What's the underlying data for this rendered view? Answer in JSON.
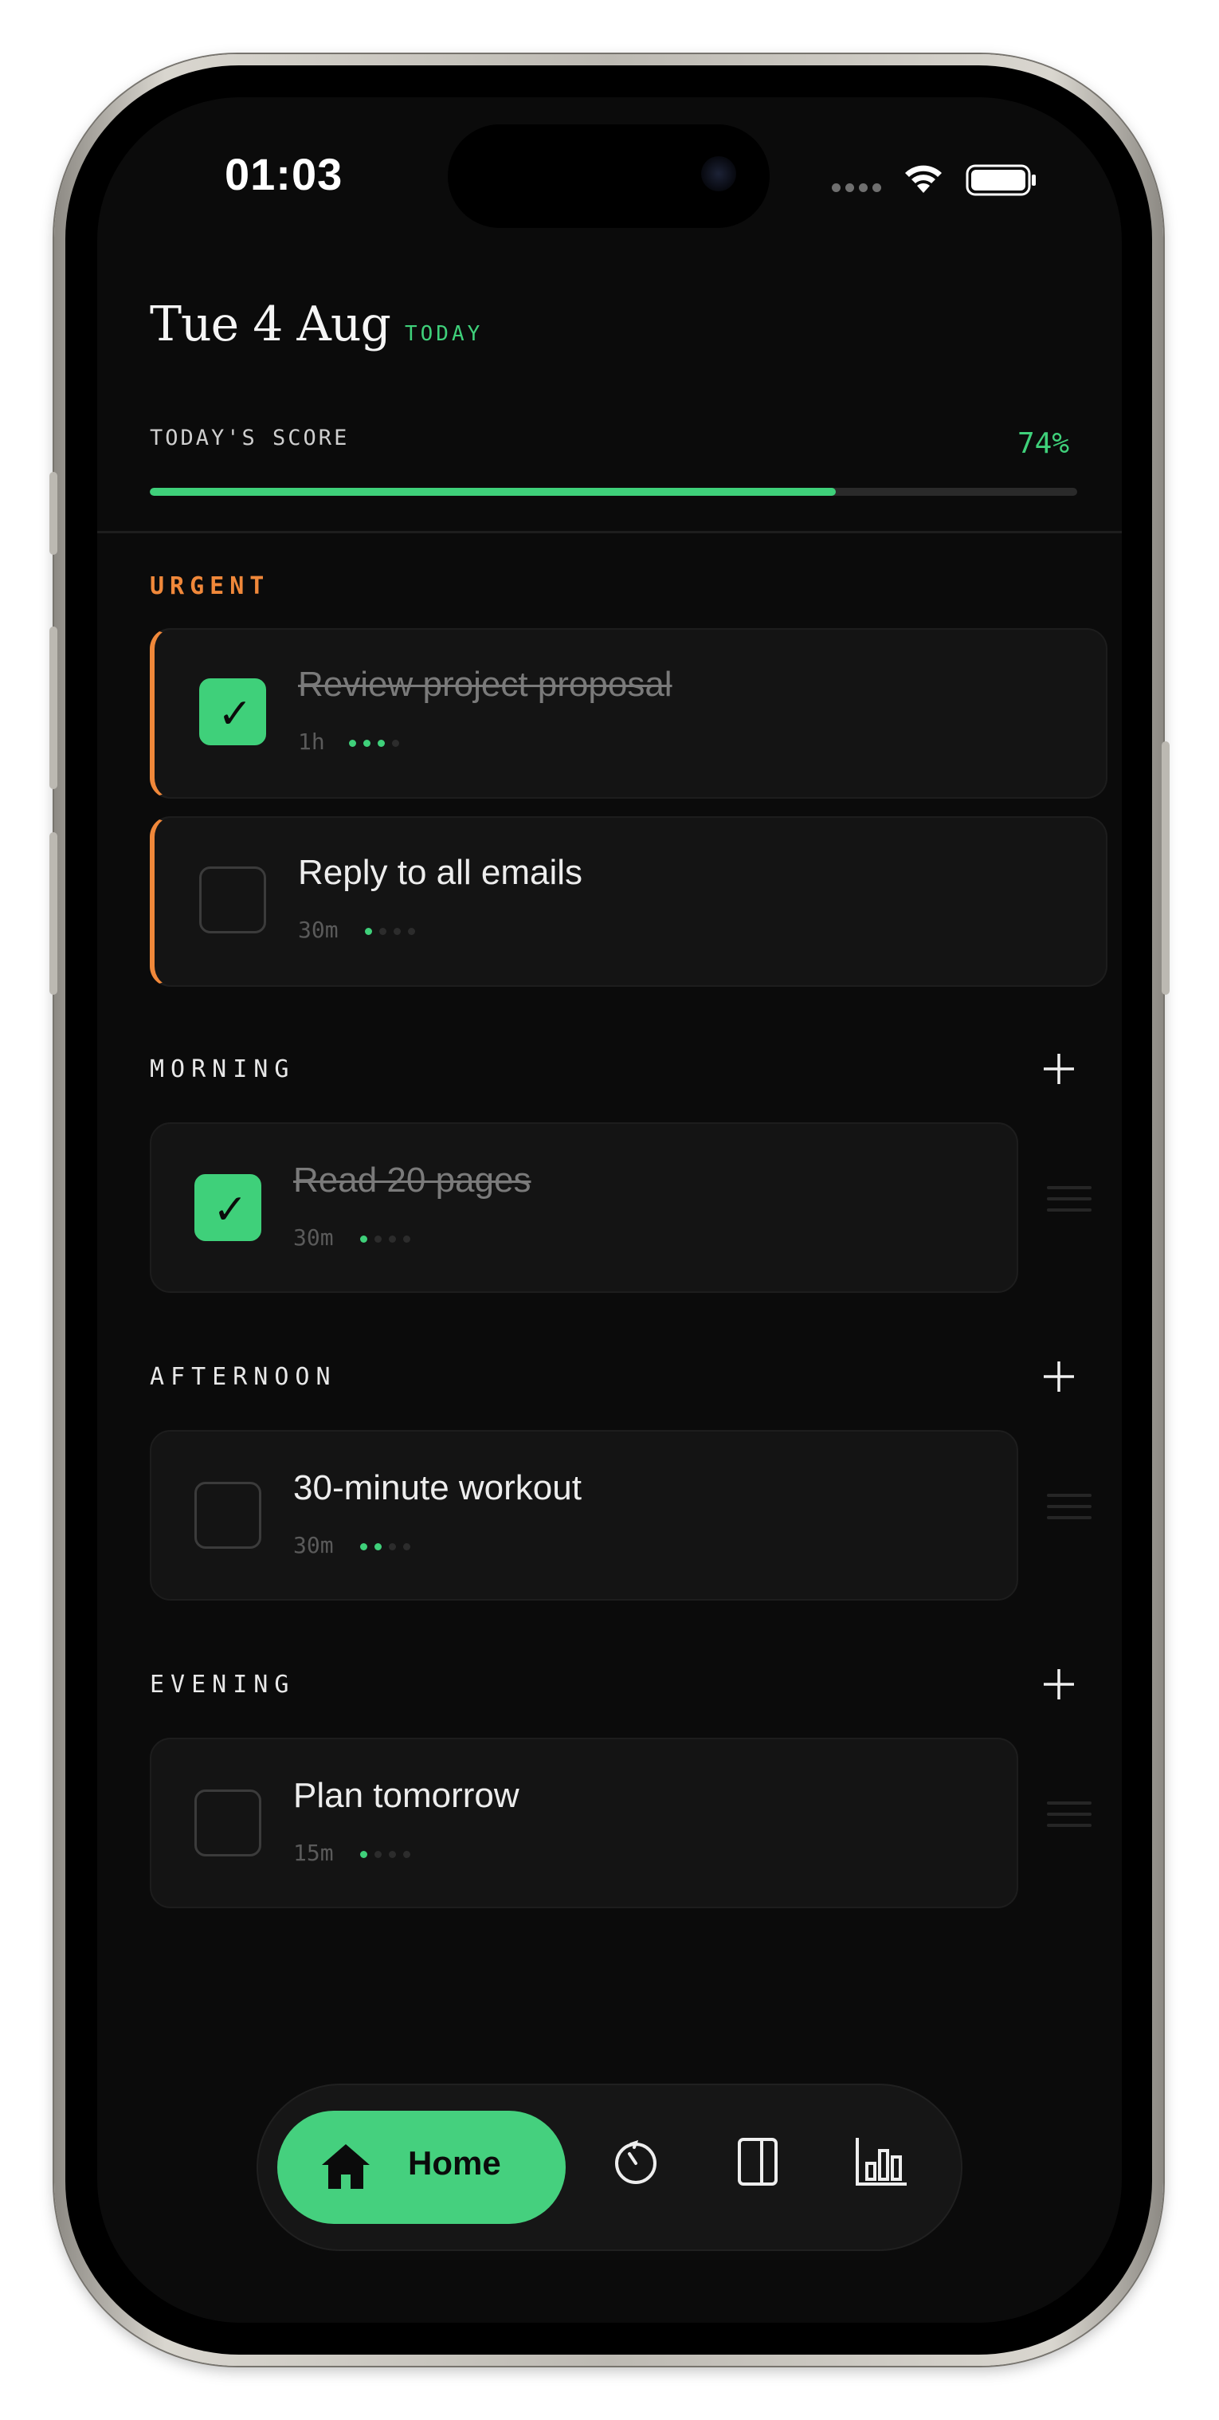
{
  "status_bar": {
    "time": "01:03"
  },
  "header": {
    "date": "Tue 4 Aug",
    "today_badge": "TODAY"
  },
  "score": {
    "label": "TODAY'S SCORE",
    "value_text": "74%",
    "progress": 0.74
  },
  "sections": {
    "urgent": {
      "title": "URGENT",
      "tasks": [
        {
          "title": "Review project proposal",
          "duration": "1h",
          "done": true,
          "level": 3
        },
        {
          "title": "Reply to all emails",
          "duration": "30m",
          "done": false,
          "level": 1
        }
      ]
    },
    "morning": {
      "title": "MORNING",
      "tasks": [
        {
          "title": "Read 20 pages",
          "duration": "30m",
          "done": true,
          "level": 1
        }
      ]
    },
    "afternoon": {
      "title": "AFTERNOON",
      "tasks": [
        {
          "title": "30-minute workout",
          "duration": "30m",
          "done": false,
          "level": 2
        }
      ]
    },
    "evening": {
      "title": "EVENING",
      "tasks": [
        {
          "title": "Plan tomorrow",
          "duration": "15m",
          "done": false,
          "level": 1
        }
      ]
    }
  },
  "nav": {
    "home_label": "Home",
    "items": [
      "home-icon",
      "timer-icon",
      "book-icon",
      "stats-icon"
    ]
  },
  "colors": {
    "accent": "#3fd07a",
    "urgent": "#f0883a",
    "background": "#0b0b0b",
    "card": "#141414"
  }
}
